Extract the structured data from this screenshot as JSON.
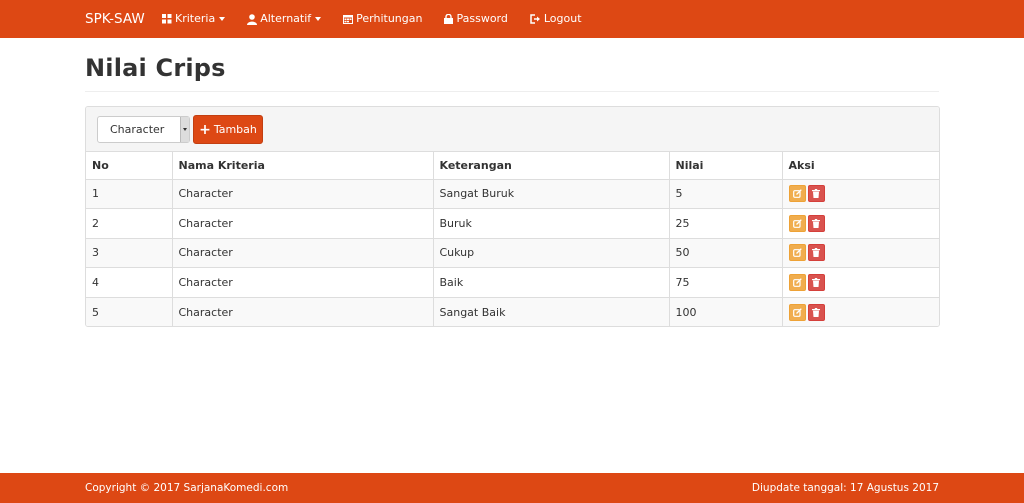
{
  "navbar": {
    "brand": "SPK-SAW",
    "items": [
      {
        "label": "Kriteria",
        "icon": "grid-icon",
        "dropdown": true
      },
      {
        "label": "Alternatif",
        "icon": "user-icon",
        "dropdown": true
      },
      {
        "label": "Perhitungan",
        "icon": "calendar-icon",
        "dropdown": false
      },
      {
        "label": "Password",
        "icon": "lock-icon",
        "dropdown": false
      },
      {
        "label": "Logout",
        "icon": "logout-icon",
        "dropdown": false
      }
    ]
  },
  "page": {
    "title": "Nilai Crips"
  },
  "toolbar": {
    "select_value": "Character",
    "add_label": "Tambah"
  },
  "table": {
    "headers": [
      "No",
      "Nama Kriteria",
      "Keterangan",
      "Nilai",
      "Aksi"
    ],
    "rows": [
      {
        "no": "1",
        "kriteria": "Character",
        "keterangan": "Sangat Buruk",
        "nilai": "5"
      },
      {
        "no": "2",
        "kriteria": "Character",
        "keterangan": "Buruk",
        "nilai": "25"
      },
      {
        "no": "3",
        "kriteria": "Character",
        "keterangan": "Cukup",
        "nilai": "50"
      },
      {
        "no": "4",
        "kriteria": "Character",
        "keterangan": "Baik",
        "nilai": "75"
      },
      {
        "no": "5",
        "kriteria": "Character",
        "keterangan": "Sangat Baik",
        "nilai": "100"
      }
    ]
  },
  "footer": {
    "copyright": "Copyright © 2017 SarjanaKomedi.com",
    "updated": "Diupdate tanggal: 17 Agustus 2017"
  },
  "colors": {
    "brand": "#dd4814",
    "edit": "#f0ad4e",
    "delete": "#d9534f"
  }
}
